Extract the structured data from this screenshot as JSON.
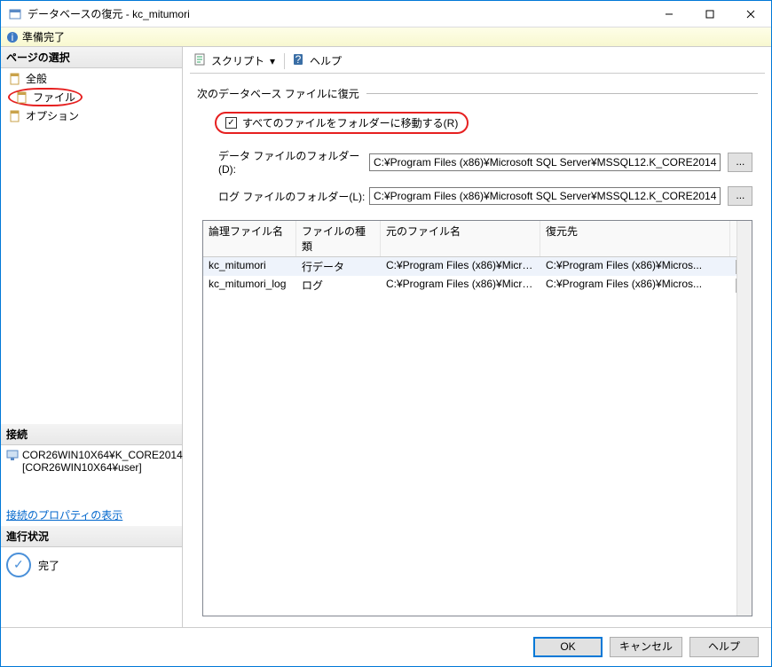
{
  "window": {
    "title": "データベースの復元 - kc_mitumori"
  },
  "status": {
    "text": "準備完了"
  },
  "sidebar": {
    "page_select_header": "ページの選択",
    "items": [
      {
        "label": "全般"
      },
      {
        "label": "ファイル"
      },
      {
        "label": "オプション"
      }
    ],
    "connection_header": "接続",
    "connection_server": "COR26WIN10X64¥K_CORE2014",
    "connection_user": "[COR26WIN10X64¥user]",
    "connection_props_link": "接続のプロパティの表示",
    "progress_header": "進行状況",
    "progress_text": "完了"
  },
  "toolbar": {
    "script_label": "スクリプト",
    "help_label": "ヘルプ"
  },
  "content": {
    "group_title": "次のデータベース ファイルに復元",
    "move_all_label": "すべてのファイルをフォルダーに移動する(R)",
    "data_folder_label": "データ ファイルのフォルダー(D):",
    "data_folder_value": "C:¥Program Files (x86)¥Microsoft SQL Server¥MSSQL12.K_CORE2014",
    "log_folder_label": "ログ ファイルのフォルダー(L):",
    "log_folder_value": "C:¥Program Files (x86)¥Microsoft SQL Server¥MSSQL12.K_CORE2014",
    "browse_label": "...",
    "columns": {
      "logical": "論理ファイル名",
      "type": "ファイルの種類",
      "original": "元のファイル名",
      "restore_as": "復元先"
    },
    "rows": [
      {
        "logical": "kc_mitumori",
        "type": "行データ",
        "original": "C:¥Program Files (x86)¥Micros...",
        "restore_as": "C:¥Program Files (x86)¥Micros..."
      },
      {
        "logical": "kc_mitumori_log",
        "type": "ログ",
        "original": "C:¥Program Files (x86)¥Micros...",
        "restore_as": "C:¥Program Files (x86)¥Micros..."
      }
    ],
    "row_browse": "..."
  },
  "buttons": {
    "ok": "OK",
    "cancel": "キャンセル",
    "help": "ヘルプ"
  }
}
